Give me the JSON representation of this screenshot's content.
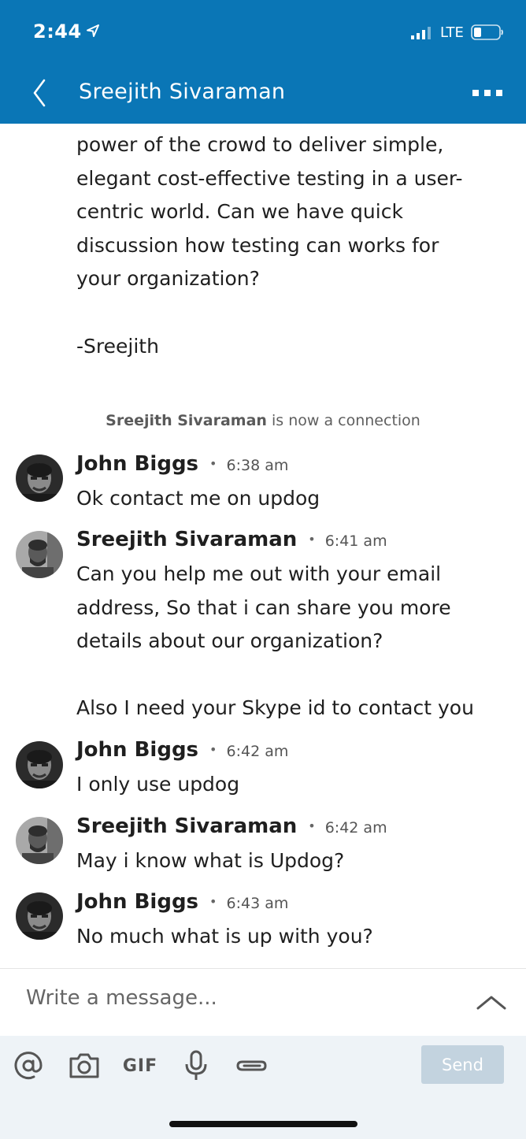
{
  "status_bar": {
    "time": "2:44",
    "network": "LTE"
  },
  "header": {
    "title": "Sreejith Sivaraman"
  },
  "first_message": {
    "text": "power of the crowd to deliver simple,\nelegant cost-effective testing in a user-\ncentric world. Can we have quick\ndiscussion how testing can works for\nyour organization?",
    "signature": "-Sreejith"
  },
  "connection_note": {
    "name": "Sreejith Sivaraman",
    "suffix": " is now a connection"
  },
  "messages": [
    {
      "sender": "John Biggs",
      "time": "6:38 am",
      "body": "Ok contact me on updog",
      "avatar": "john-biggs-avatar"
    },
    {
      "sender": "Sreejith Sivaraman",
      "time": "6:41 am",
      "body": "Can you help me out with your email\naddress, So that i can share you more\ndetails about our organization?\n\nAlso I need your Skype id to contact you",
      "avatar": "sreejith-avatar"
    },
    {
      "sender": "John Biggs",
      "time": "6:42 am",
      "body": "I only use updog",
      "avatar": "john-biggs-avatar"
    },
    {
      "sender": "Sreejith Sivaraman",
      "time": "6:42 am",
      "body": "May i know what is Updog?",
      "avatar": "sreejith-avatar"
    },
    {
      "sender": "John Biggs",
      "time": "6:43 am",
      "body": "No much what is up with you?",
      "avatar": "john-biggs-avatar"
    }
  ],
  "compose": {
    "placeholder": "Write a message...",
    "send_label": "Send"
  },
  "toolbar": {
    "gif_label": "GIF"
  },
  "colors": {
    "header_bg": "#0a76b6",
    "toolbar_bg": "#eef3f7",
    "send_disabled": "#c3d3df"
  }
}
